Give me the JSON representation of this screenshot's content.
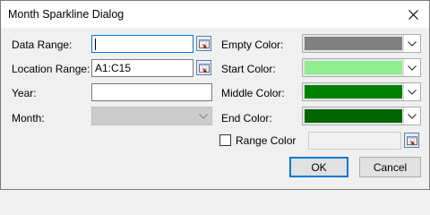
{
  "window": {
    "title": "Month Sparkline Dialog"
  },
  "fields": {
    "data_range": {
      "label": "Data Range:",
      "value": ""
    },
    "location_range": {
      "label": "Location Range:",
      "value": "A1:C15"
    },
    "year": {
      "label": "Year:",
      "value": ""
    },
    "month": {
      "label": "Month:",
      "value": ""
    }
  },
  "colors": {
    "empty": {
      "label": "Empty Color:",
      "color": "#808080"
    },
    "start": {
      "label": "Start Color:",
      "color": "#90ee90"
    },
    "middle": {
      "label": "Middle Color:",
      "color": "#008000"
    },
    "end": {
      "label": "End Color:",
      "color": "#006400"
    }
  },
  "range_color": {
    "label": "Range Color",
    "checked": false
  },
  "buttons": {
    "ok": "OK",
    "cancel": "Cancel"
  },
  "icons": {
    "close": "close-icon",
    "range_picker": "range-picker-icon",
    "dropdown": "chevron-down-icon"
  }
}
